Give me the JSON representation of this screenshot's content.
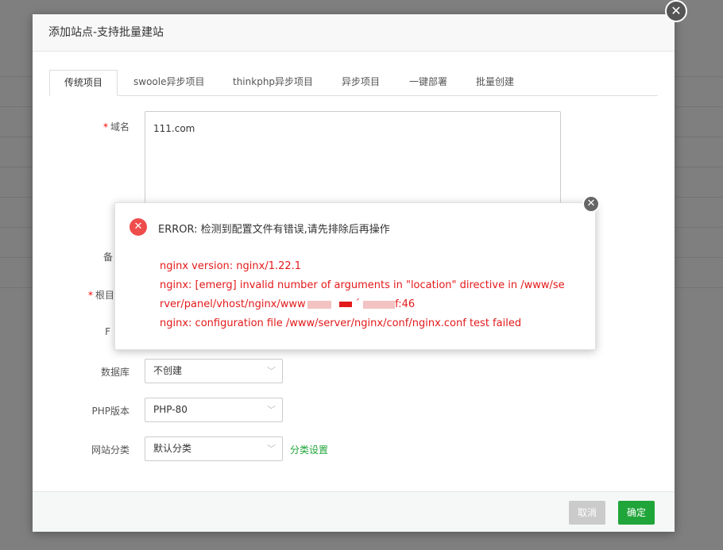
{
  "dialog": {
    "title": "添加站点-支持批量建站",
    "close_glyph": "✕"
  },
  "tabs": [
    {
      "label": "传统项目",
      "active": true
    },
    {
      "label": "swoole异步项目"
    },
    {
      "label": "thinkphp异步项目"
    },
    {
      "label": "异步项目"
    },
    {
      "label": "一键部署"
    },
    {
      "label": "批量创建"
    }
  ],
  "form": {
    "required_mark": "*",
    "domain_label": "域名",
    "domain_value": "111.com",
    "partial_label_1": "备",
    "root_label": "根目",
    "partial_label_2": "F",
    "database_label": "数据库",
    "database_value": "不创建",
    "php_label": "PHP版本",
    "php_value": "PHP-80",
    "category_label": "网站分类",
    "category_value": "默认分类",
    "category_settings_link": "分类设置",
    "chevron_glyph": "﹀"
  },
  "footer": {
    "cancel_label": "取消",
    "ok_label": "确定"
  },
  "error": {
    "icon_glyph": "✕",
    "close_glyph": "✕",
    "title": "ERROR: 检测到配置文件有错误,请先排除后再操作",
    "line1": "nginx version: nginx/1.22.1",
    "line2": "nginx: [emerg] invalid number of arguments in \"location\" directive in /www/se",
    "line3_start": "rver/panel/vhost/nginx/www",
    "line3_mid": "´",
    "line3_end": "f:46",
    "line4": "nginx: configuration file /www/server/nginx/conf/nginx.conf test failed"
  },
  "colors": {
    "accent_green": "#20a53a",
    "error_red": "#e3191a",
    "error_icon": "#ef4c4c"
  }
}
